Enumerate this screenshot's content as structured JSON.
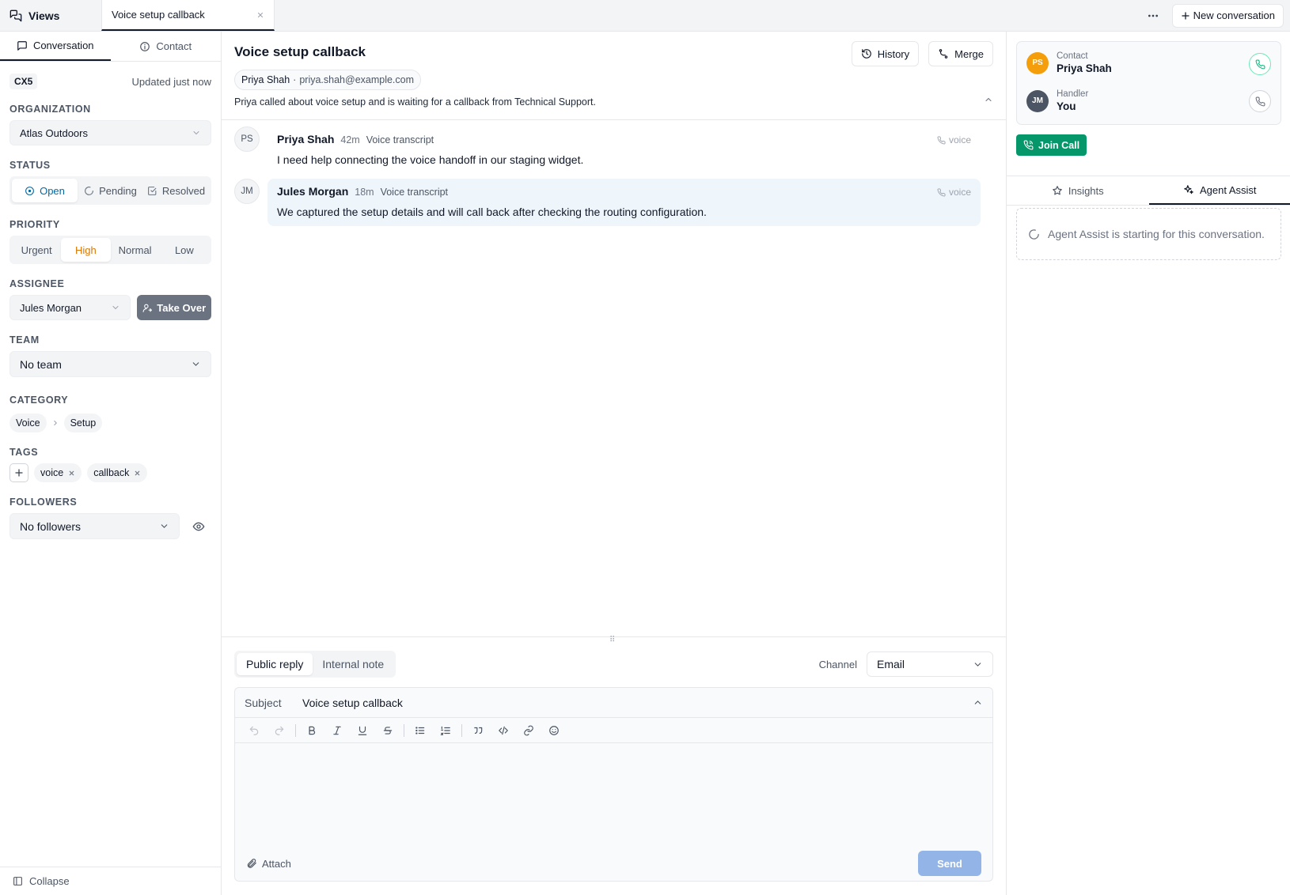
{
  "topbar": {
    "views_label": "Views",
    "active_tab_label": "Voice setup callback",
    "new_conversation_label": "New conversation"
  },
  "left": {
    "tabs": [
      {
        "label": "Conversation",
        "icon": "message-icon",
        "active": true
      },
      {
        "label": "Contact",
        "icon": "info-icon",
        "active": false
      }
    ],
    "conversation_id": "CX5",
    "updated": "Updated just now",
    "organization": {
      "label": "ORGANIZATION",
      "value": "Atlas Outdoors"
    },
    "status": {
      "label": "STATUS",
      "options": [
        "Open",
        "Pending",
        "Resolved"
      ],
      "selected": "Open"
    },
    "priority": {
      "label": "PRIORITY",
      "options": [
        "Urgent",
        "High",
        "Normal",
        "Low"
      ],
      "selected": "High"
    },
    "assignee": {
      "label": "ASSIGNEE",
      "value": "Jules Morgan",
      "take_over_label": "Take Over"
    },
    "team": {
      "label": "TEAM",
      "value": "No team"
    },
    "category": {
      "label": "CATEGORY",
      "path": [
        "Voice",
        "Setup"
      ]
    },
    "tags": {
      "label": "TAGS",
      "items": [
        "voice",
        "callback"
      ]
    },
    "followers": {
      "label": "FOLLOWERS",
      "value": "No followers"
    },
    "collapse_label": "Collapse"
  },
  "center": {
    "title": "Voice setup callback",
    "history_label": "History",
    "merge_label": "Merge",
    "contact_name": "Priya Shah",
    "contact_email": "priya.shah@example.com",
    "summary": "Priya called about voice setup and is waiting for a callback from Technical Support.",
    "messages": [
      {
        "initials": "PS",
        "author": "Priya Shah",
        "time": "42m",
        "kind": "Voice transcript",
        "channel": "voice",
        "text": "I need help connecting the voice handoff in our staging widget."
      },
      {
        "initials": "JM",
        "author": "Jules Morgan",
        "time": "18m",
        "kind": "Voice transcript",
        "channel": "voice",
        "text": "We captured the setup details and will call back after checking the routing configuration."
      }
    ],
    "composer": {
      "modes": [
        "Public reply",
        "Internal note"
      ],
      "selected_mode": "Public reply",
      "channel_label": "Channel",
      "channel_value": "Email",
      "subject_label": "Subject",
      "subject_value": "Voice setup callback",
      "attach_label": "Attach",
      "send_label": "Send"
    }
  },
  "right": {
    "contact": {
      "role": "Contact",
      "name": "Priya Shah",
      "initials": "PS",
      "avatar_color": "#f59e0b"
    },
    "handler": {
      "role": "Handler",
      "name": "You",
      "initials": "JM",
      "avatar_color": "#4b5563"
    },
    "join_call_label": "Join Call",
    "tabs": [
      {
        "label": "Insights",
        "icon": "star-icon",
        "active": false
      },
      {
        "label": "Agent Assist",
        "icon": "sparkle-icon",
        "active": true
      }
    ],
    "assist_message": "Agent Assist is starting for this conversation."
  }
}
